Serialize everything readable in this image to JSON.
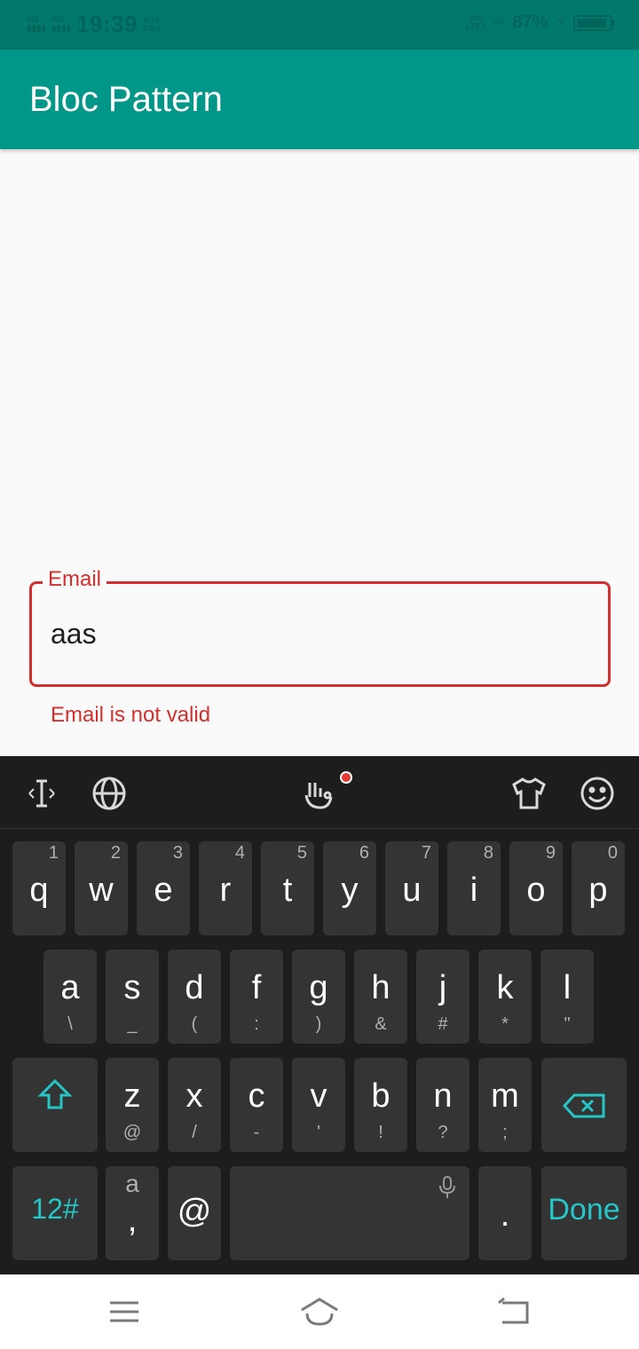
{
  "status": {
    "net_top": "4G",
    "net_top2": "4G",
    "time": "19:39",
    "speed_value": "8.10",
    "speed_unit": "KB/s",
    "volte": "Vol",
    "lte": "LTE1",
    "net_right": "4G",
    "battery_pct": "87%",
    "battery_level": 0.87
  },
  "appbar": {
    "title": "Bloc Pattern"
  },
  "form": {
    "email_label": "Email",
    "email_value": "aas",
    "email_error": "Email is not valid",
    "error_color": "#d32f2f"
  },
  "keyboard": {
    "toolbar": [
      "cursor-icon",
      "globe-icon",
      "gesture-icon",
      "theme-shirt-icon",
      "emoji-icon"
    ],
    "row1": [
      {
        "k": "q",
        "n": "1"
      },
      {
        "k": "w",
        "n": "2"
      },
      {
        "k": "e",
        "n": "3"
      },
      {
        "k": "r",
        "n": "4"
      },
      {
        "k": "t",
        "n": "5"
      },
      {
        "k": "y",
        "n": "6"
      },
      {
        "k": "u",
        "n": "7"
      },
      {
        "k": "i",
        "n": "8"
      },
      {
        "k": "o",
        "n": "9"
      },
      {
        "k": "p",
        "n": "0"
      }
    ],
    "row2": [
      {
        "k": "a",
        "s": "\\"
      },
      {
        "k": "s",
        "s": "_"
      },
      {
        "k": "d",
        "s": "("
      },
      {
        "k": "f",
        "s": ":"
      },
      {
        "k": "g",
        "s": ")"
      },
      {
        "k": "h",
        "s": "&"
      },
      {
        "k": "j",
        "s": "#"
      },
      {
        "k": "k",
        "s": "*"
      },
      {
        "k": "l",
        "s": "\""
      }
    ],
    "row3": [
      {
        "k": "z",
        "s": "@"
      },
      {
        "k": "x",
        "s": "/"
      },
      {
        "k": "c",
        "s": "-"
      },
      {
        "k": "v",
        "s": "'"
      },
      {
        "k": "b",
        "s": "!"
      },
      {
        "k": "n",
        "s": "?"
      },
      {
        "k": "m",
        "s": ";"
      }
    ],
    "mode_label": "12#",
    "comma_top": "a",
    "comma_label": ",",
    "at_label": "@",
    "period_label": ".",
    "done_label": "Done",
    "accent": "#26c6c6"
  },
  "navbar": [
    "menu-icon",
    "home-icon",
    "back-icon"
  ]
}
